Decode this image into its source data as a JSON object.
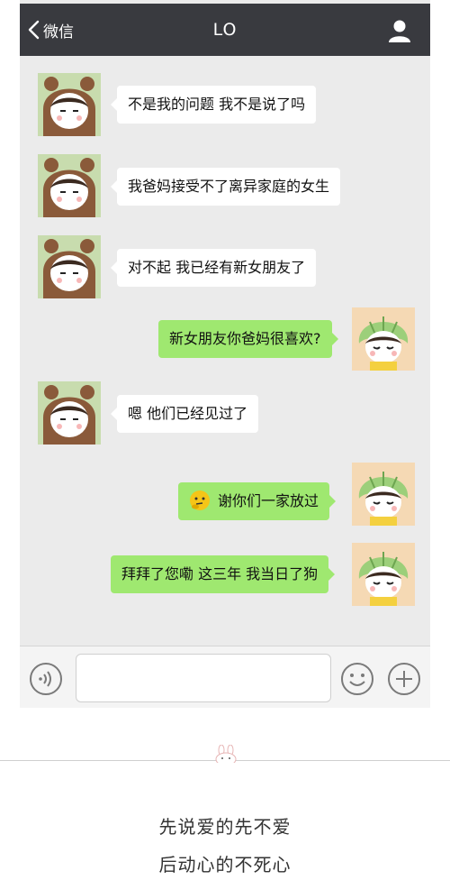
{
  "nav": {
    "back_label": "微信",
    "title": "LO"
  },
  "messages": [
    {
      "side": "in",
      "text": "不是我的问题  我不是说了吗",
      "avatar": "boy-bear-hat-avatar"
    },
    {
      "side": "in",
      "text": "我爸妈接受不了离异家庭的女生",
      "avatar": "boy-bear-hat-avatar"
    },
    {
      "side": "in",
      "text": "对不起 我已经有新女朋友了",
      "avatar": "boy-bear-hat-avatar"
    },
    {
      "side": "out",
      "text": "新女朋友你爸妈很喜欢?",
      "avatar": "girl-cabbage-hat-avatar"
    },
    {
      "side": "in",
      "text": "嗯 他们已经见过了",
      "avatar": "boy-bear-hat-avatar"
    },
    {
      "side": "out",
      "text": "谢你们一家放过",
      "emoji": "thinking-face-emoji",
      "avatar": "girl-cabbage-hat-avatar"
    },
    {
      "side": "out",
      "text": "拜拜了您嘞  这三年 我当日了狗",
      "avatar": "girl-cabbage-hat-avatar"
    }
  ],
  "input": {
    "voice_icon": "voice-icon",
    "emoji_icon": "emoji-icon",
    "plus_icon": "plus-icon",
    "value": ""
  },
  "caption": {
    "line1": "先说爱的先不爱",
    "line2": "后动心的不死心"
  },
  "colors": {
    "navbar": "#393a3f",
    "chat_bg": "#ebebeb",
    "bubble_out": "#9fe870",
    "bubble_in": "#ffffff"
  }
}
